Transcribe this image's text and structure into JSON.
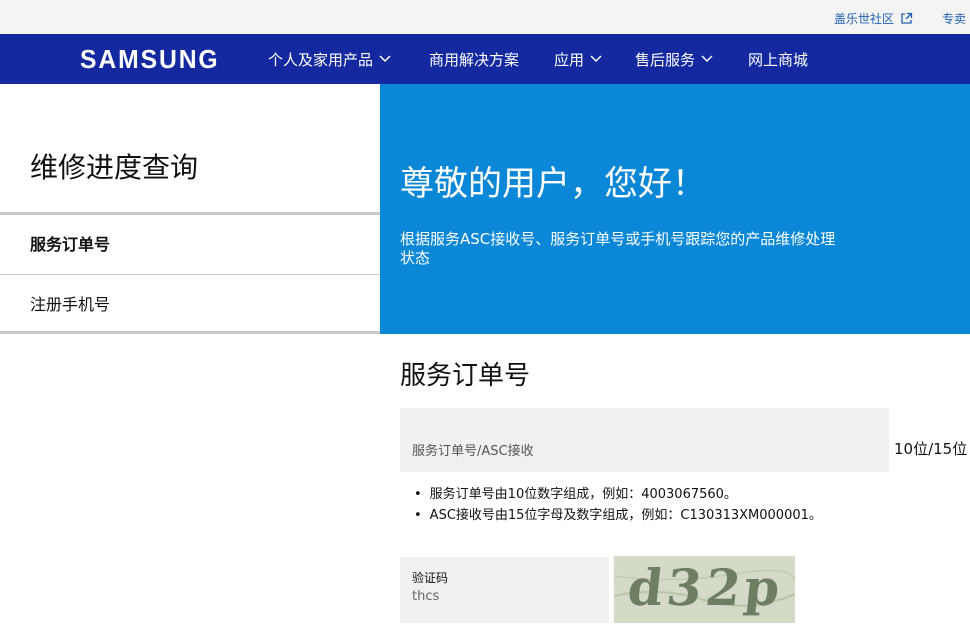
{
  "utility_bar": {
    "community_link": "盖乐世社区",
    "partial_link": "专卖"
  },
  "nav": {
    "logo": "SAMSUNG",
    "menu": [
      {
        "label": "个人及家用产品",
        "has_dropdown": true
      },
      {
        "label": "商用解决方案",
        "has_dropdown": false
      },
      {
        "label": "应用",
        "has_dropdown": true
      },
      {
        "label": "售后服务",
        "has_dropdown": true
      },
      {
        "label": "网上商城",
        "has_dropdown": false
      }
    ]
  },
  "sidebar": {
    "title": "维修进度查询",
    "items": [
      {
        "label": "服务订单号",
        "active": true
      },
      {
        "label": "注册手机号",
        "active": false
      }
    ]
  },
  "hero": {
    "title": "尊敬的用户，您好！",
    "subtitle": "根据服务ASC接收号、服务订单号或手机号跟踪您的产品维修处理状态"
  },
  "form": {
    "section_title": "服务订单号",
    "order_field": {
      "label": "服务订单号/ASC接收",
      "hint": "10位/15位"
    },
    "notes": [
      "服务订单号由10位数字组成，例如：4003067560。",
      "ASC接收号由15位字母及数字组成，例如：C130313XM000001。"
    ],
    "captcha": {
      "label": "验证码",
      "value": "thcs",
      "image_text": "d32p"
    }
  },
  "colors": {
    "nav_bg": "#1428a0",
    "hero_bg": "#0b87d8",
    "link": "#1d5fb3"
  }
}
